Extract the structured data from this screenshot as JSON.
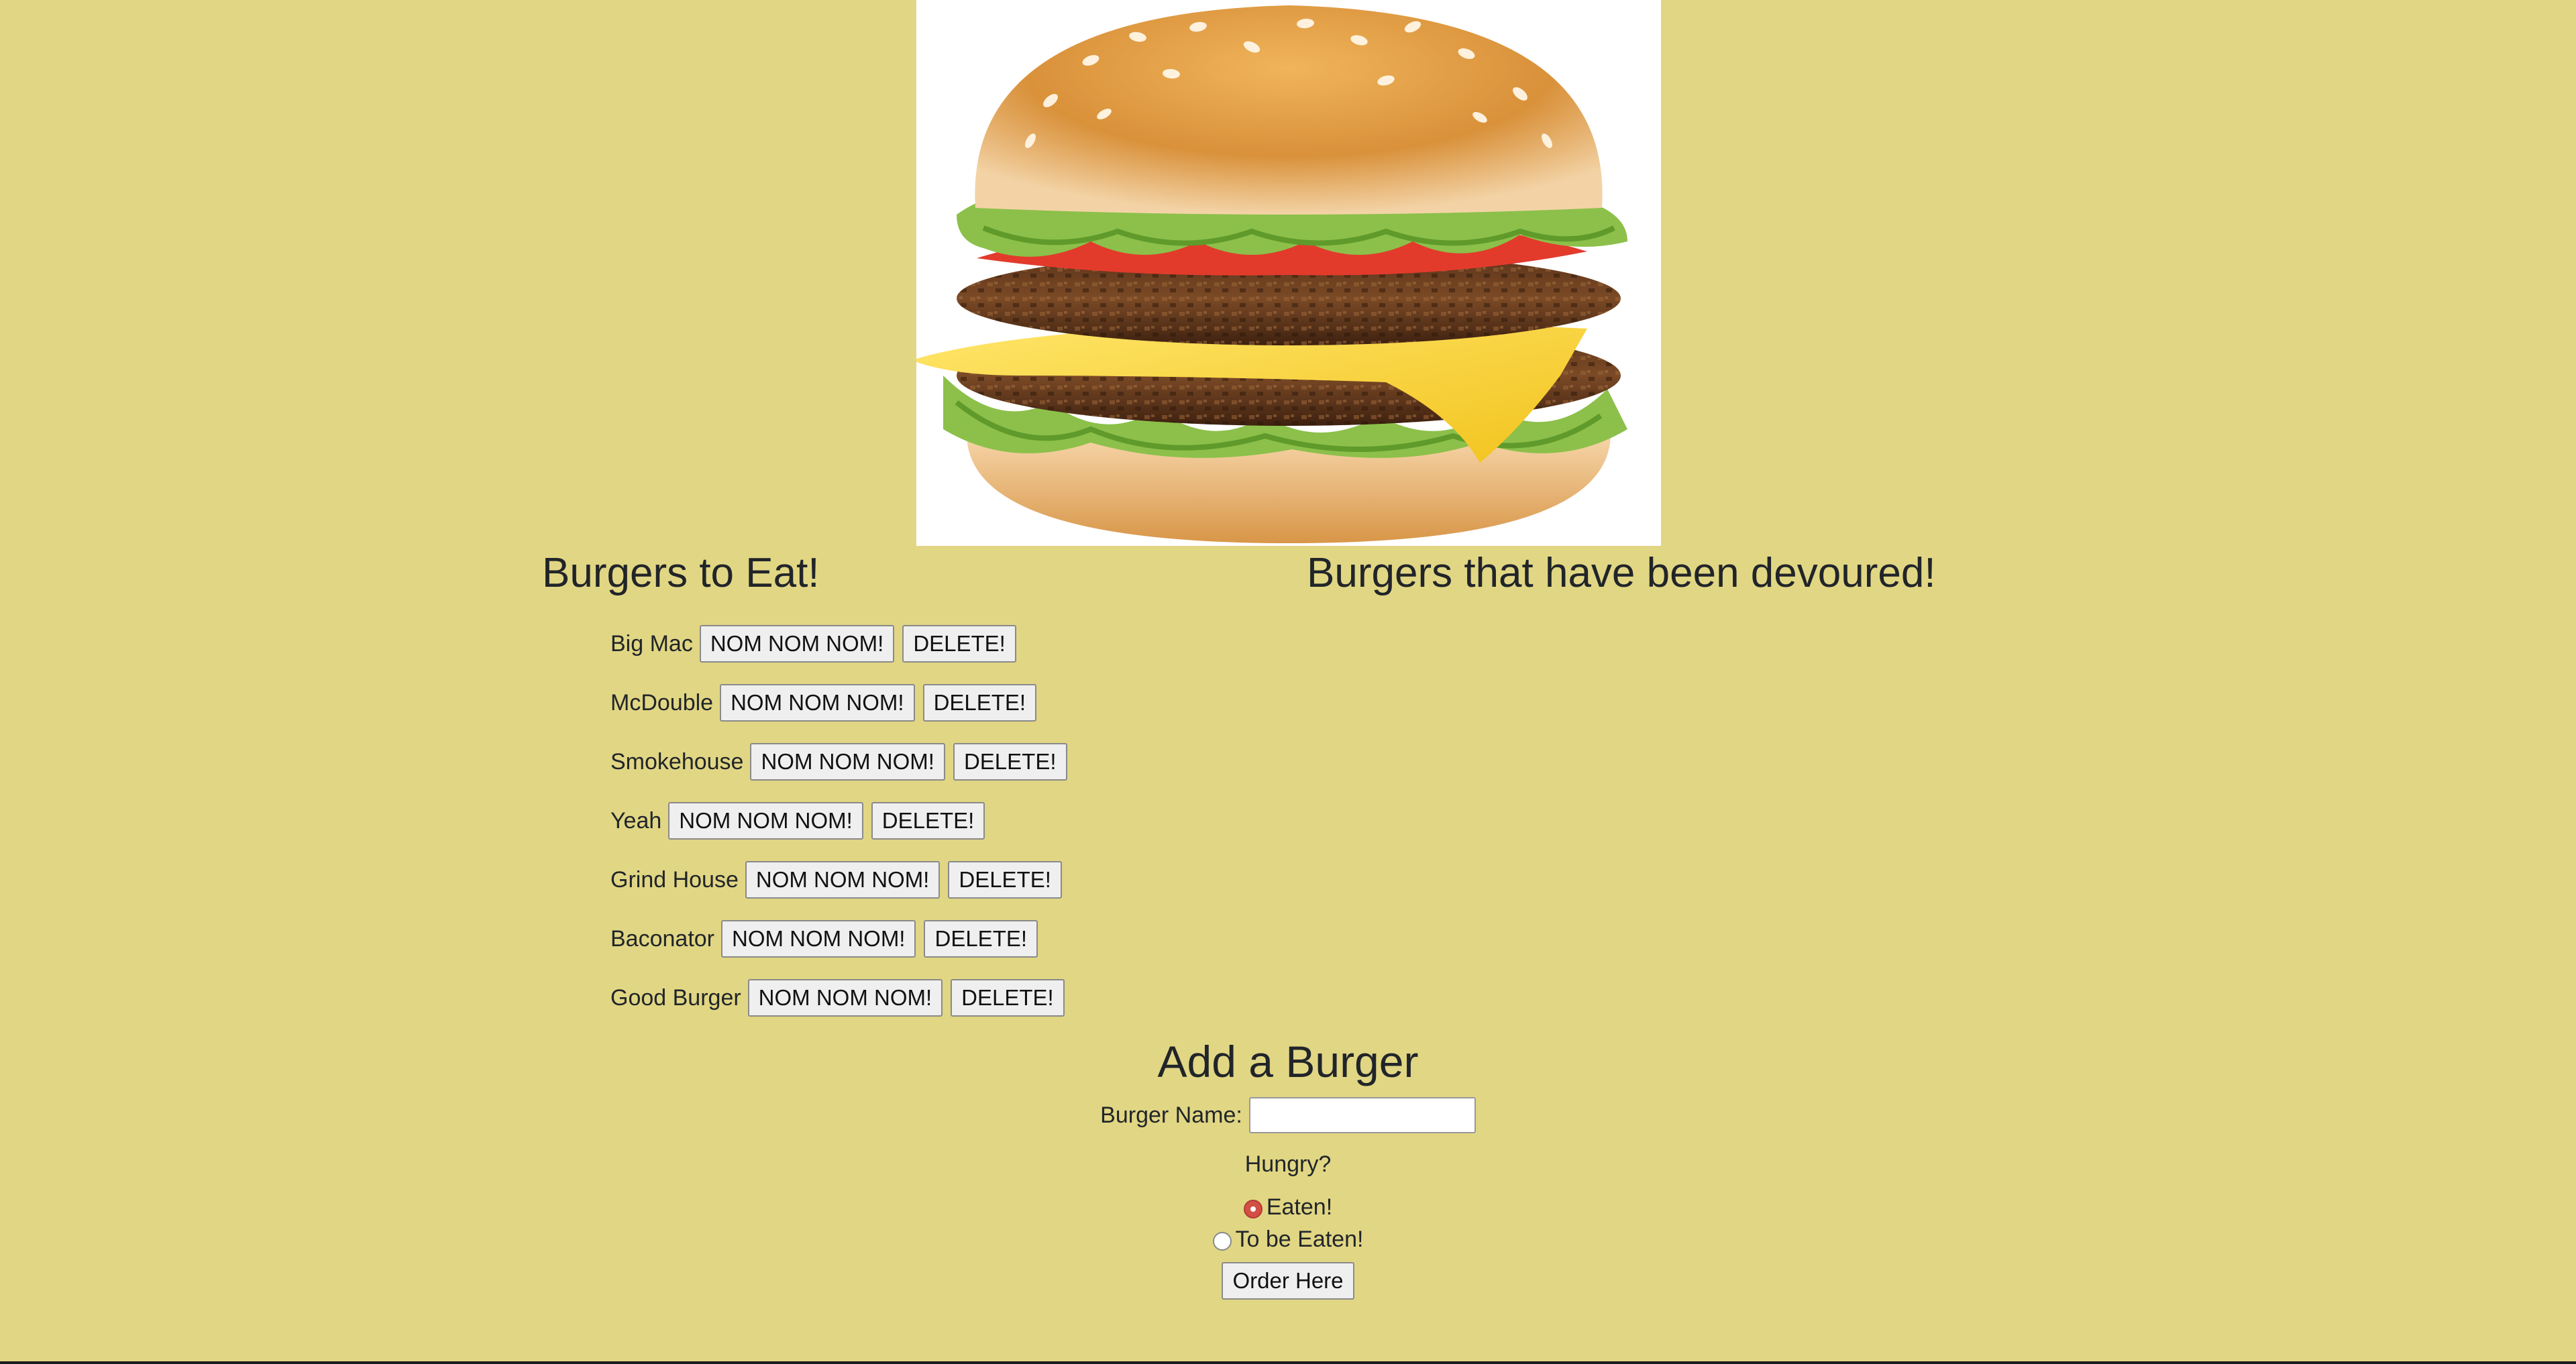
{
  "hero": {
    "image_alt": "double burger illustration"
  },
  "columns": {
    "to_eat_heading": "Burgers to Eat!",
    "devoured_heading": "Burgers that have been devoured!"
  },
  "burgers_to_eat": [
    {
      "name": "Big Mac",
      "devour_label": "NOM NOM NOM!",
      "delete_label": "DELETE!"
    },
    {
      "name": "McDouble",
      "devour_label": "NOM NOM NOM!",
      "delete_label": "DELETE!"
    },
    {
      "name": "Smokehouse",
      "devour_label": "NOM NOM NOM!",
      "delete_label": "DELETE!"
    },
    {
      "name": "Yeah",
      "devour_label": "NOM NOM NOM!",
      "delete_label": "DELETE!"
    },
    {
      "name": "Grind House",
      "devour_label": "NOM NOM NOM!",
      "delete_label": "DELETE!"
    },
    {
      "name": "Baconator",
      "devour_label": "NOM NOM NOM!",
      "delete_label": "DELETE!"
    },
    {
      "name": "Good Burger",
      "devour_label": "NOM NOM NOM!",
      "delete_label": "DELETE!"
    }
  ],
  "burgers_devoured": [],
  "form": {
    "title": "Add a Burger",
    "name_label": "Burger Name:",
    "name_value": "",
    "hungry_label": "Hungry?",
    "option_eaten": "Eaten!",
    "option_to_be_eaten": "To be Eaten!",
    "selected_option": "Eaten!",
    "submit_label": "Order Here"
  },
  "colors": {
    "background": "#e1d684",
    "radio_selected": "#d34f46"
  }
}
